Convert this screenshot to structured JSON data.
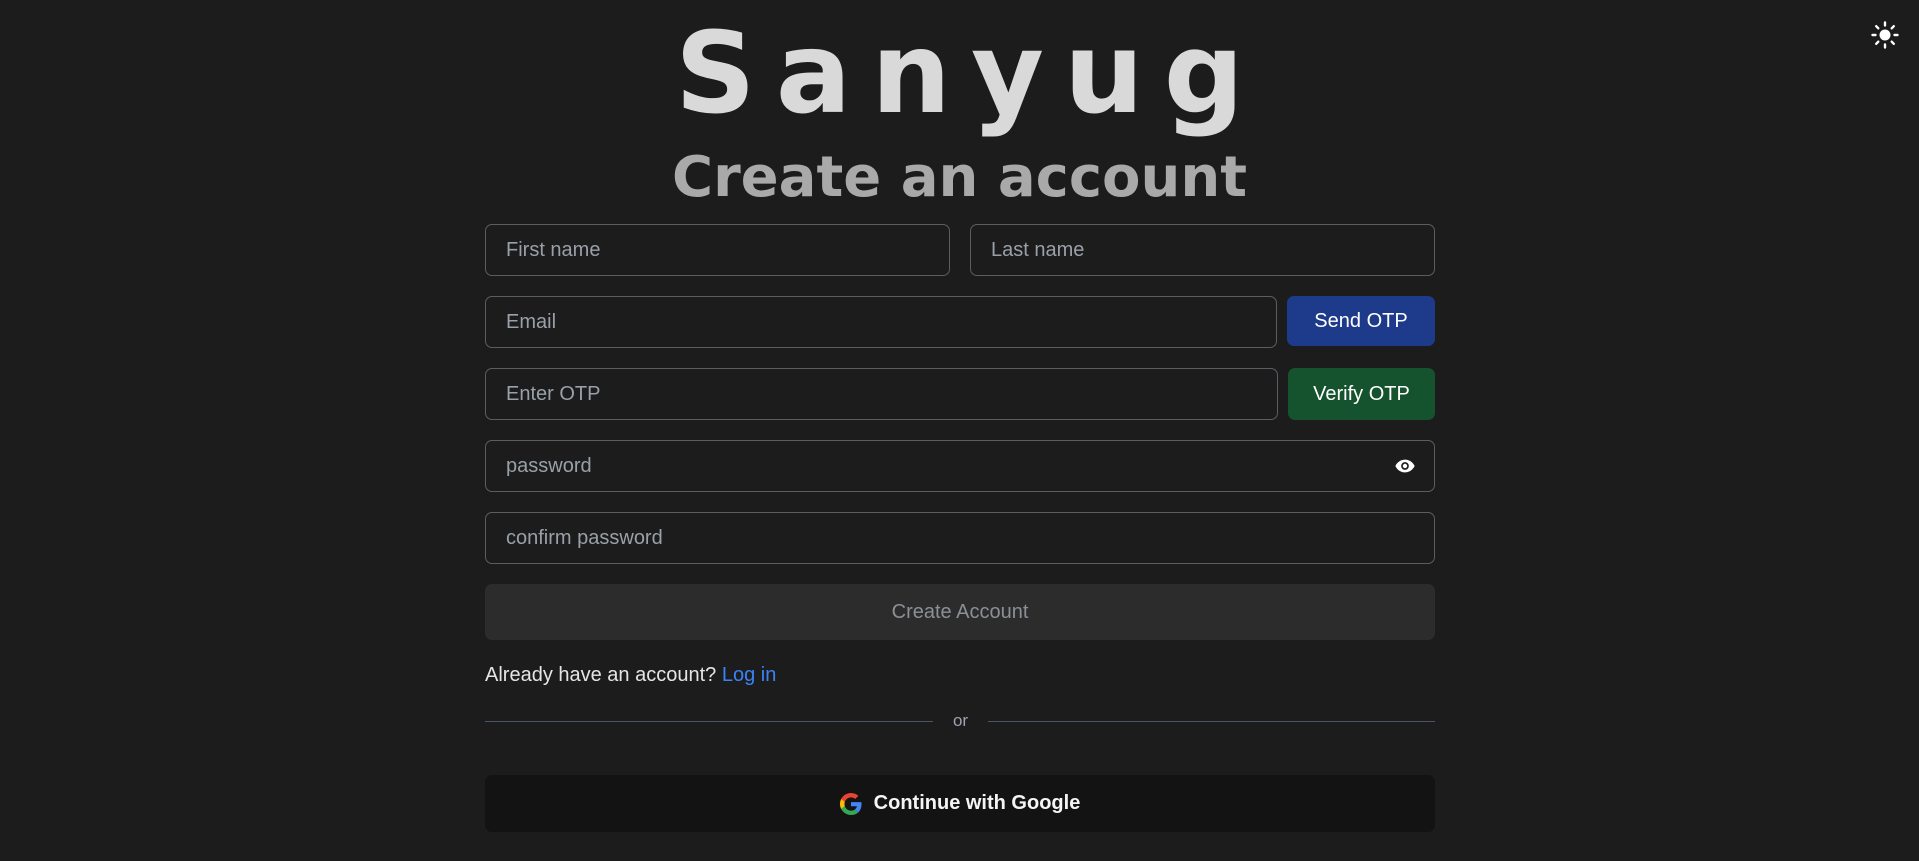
{
  "app": {
    "brand": "Sanyug",
    "heading": "Create an account"
  },
  "theme_toggle": {
    "icon": "sun-icon"
  },
  "form": {
    "first_name_placeholder": "First name",
    "last_name_placeholder": "Last name",
    "email_placeholder": "Email",
    "send_otp_label": "Send OTP",
    "otp_placeholder": "Enter OTP",
    "verify_otp_label": "Verify OTP",
    "password_placeholder": "password",
    "password_toggle_icon": "eye-icon",
    "confirm_password_placeholder": "confirm password",
    "create_account_label": "Create Account"
  },
  "login_prompt": {
    "text": "Already have an account?",
    "link_label": "Log in"
  },
  "divider": {
    "text": "or"
  },
  "google": {
    "icon": "google-logo-icon",
    "label": "Continue with Google"
  },
  "colors": {
    "background": "#1c1c1c",
    "send_otp": "#1e3a8a",
    "verify_otp": "#14532d",
    "link": "#3b82f6",
    "create_account_bg": "#2c2c2c",
    "google_bg": "#131313"
  }
}
